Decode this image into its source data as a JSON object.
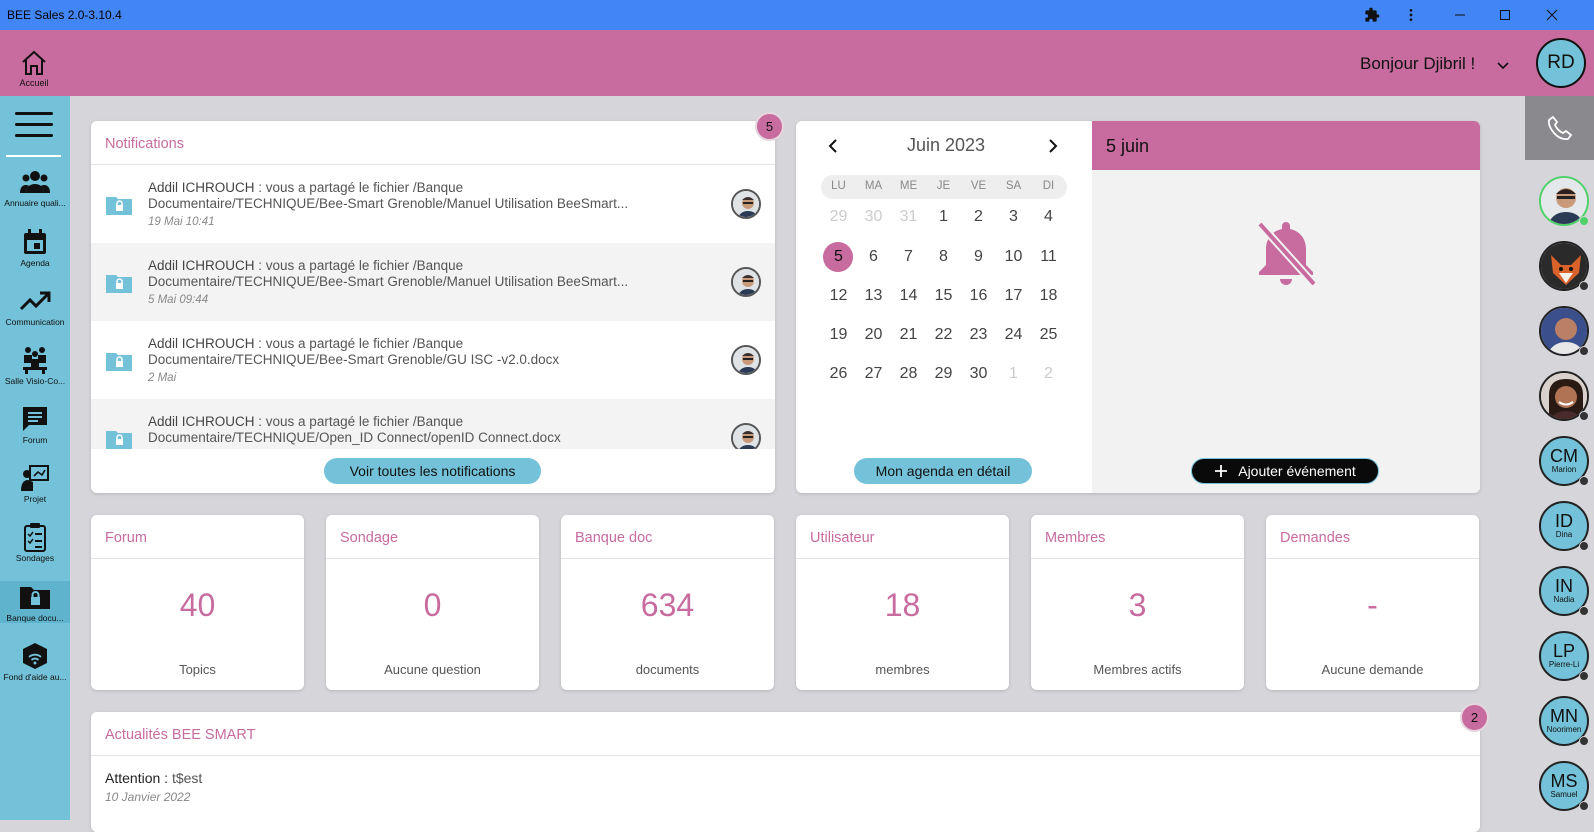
{
  "window": {
    "title": "BEE Sales 2.0-3.10.4"
  },
  "colors": {
    "brand": "#c86b9f",
    "accent": "#74c2d9",
    "titlebar": "#4285f4"
  },
  "header": {
    "home_label": "Accueil",
    "greeting": "Bonjour Djibril !",
    "user_initials": "RD"
  },
  "sidebar": {
    "items": [
      {
        "label": "Annuaire quali...",
        "icon": "people-icon"
      },
      {
        "label": "Agenda",
        "icon": "calendar-icon"
      },
      {
        "label": "Communication",
        "icon": "trending-up-icon"
      },
      {
        "label": "Salle Visio-Co...",
        "icon": "meeting-room-icon"
      },
      {
        "label": "Forum",
        "icon": "chat-icon"
      },
      {
        "label": "Projet",
        "icon": "presentation-icon"
      },
      {
        "label": "Sondages",
        "icon": "clipboard-icon"
      },
      {
        "label": "Banque docu...",
        "icon": "locked-folder-icon"
      },
      {
        "label": "Fond d'aide au...",
        "icon": "wifi-box-icon"
      }
    ]
  },
  "notifications": {
    "title": "Notifications",
    "count": "5",
    "items": [
      {
        "author": "Addil ICHROUCH",
        "line1": " : vous a partagé le fichier /Banque",
        "line2": "Documentaire/TECHNIQUE/Bee-Smart Grenoble/Manuel Utilisation BeeSmart...",
        "time": "19 Mai 10:41"
      },
      {
        "author": "Addil ICHROUCH",
        "line1": " : vous a partagé le fichier /Banque",
        "line2": "Documentaire/TECHNIQUE/Bee-Smart Grenoble/Manuel Utilisation BeeSmart...",
        "time": "5 Mai 09:44"
      },
      {
        "author": "Addil ICHROUCH",
        "line1": " : vous a partagé le fichier /Banque",
        "line2": "Documentaire/TECHNIQUE/Bee-Smart Grenoble/GU ISC -v2.0.docx",
        "time": "2 Mai"
      },
      {
        "author": "Addil ICHROUCH",
        "line1": " : vous a partagé le fichier /Banque",
        "line2": "Documentaire/TECHNIQUE/Open_ID Connect/openID Connect.docx",
        "time": ""
      }
    ],
    "see_all": "Voir toutes les notifications"
  },
  "calendar": {
    "month": "Juin 2023",
    "weekdays": [
      "LU",
      "MA",
      "ME",
      "JE",
      "VE",
      "SA",
      "DI"
    ],
    "weeks": [
      [
        "29",
        "30",
        "31",
        "1",
        "2",
        "3",
        "4"
      ],
      [
        "5",
        "6",
        "7",
        "8",
        "9",
        "10",
        "11"
      ],
      [
        "12",
        "13",
        "14",
        "15",
        "16",
        "17",
        "18"
      ],
      [
        "19",
        "20",
        "21",
        "22",
        "23",
        "24",
        "25"
      ],
      [
        "26",
        "27",
        "28",
        "29",
        "30",
        "1",
        "2"
      ]
    ],
    "selected_day": "5",
    "detail_button": "Mon agenda en détail",
    "day_title": "5 juin",
    "add_event": "Ajouter événement"
  },
  "stats": [
    {
      "title": "Forum",
      "value": "40",
      "label": "Topics"
    },
    {
      "title": "Sondage",
      "value": "0",
      "label": "Aucune question"
    },
    {
      "title": "Banque doc",
      "value": "634",
      "label": "documents"
    },
    {
      "title": "Utilisateur",
      "value": "18",
      "label": "membres"
    },
    {
      "title": "Membres",
      "value": "3",
      "label": "Membres actifs"
    },
    {
      "title": "Demandes",
      "value": "-",
      "label": "Aucune demande"
    }
  ],
  "news": {
    "title": "Actualités BEE SMART",
    "count": "2",
    "item_label": "Attention : ",
    "item_text": "t$est",
    "item_date": "10 Janvier 2022"
  },
  "contacts": [
    {
      "initials": "",
      "name": "",
      "status": "online"
    },
    {
      "initials": "",
      "name": "",
      "status": "offline"
    },
    {
      "initials": "",
      "name": "",
      "status": "offline"
    },
    {
      "initials": "",
      "name": "",
      "status": "offline"
    },
    {
      "initials": "CM",
      "name": "Marion",
      "status": "offline"
    },
    {
      "initials": "ID",
      "name": "Dina",
      "status": "offline"
    },
    {
      "initials": "IN",
      "name": "Nadia",
      "status": "offline"
    },
    {
      "initials": "LP",
      "name": "Pierre-Li",
      "status": "offline"
    },
    {
      "initials": "MN",
      "name": "Noorimen",
      "status": "offline"
    },
    {
      "initials": "MS",
      "name": "Samuel",
      "status": "offline"
    }
  ]
}
